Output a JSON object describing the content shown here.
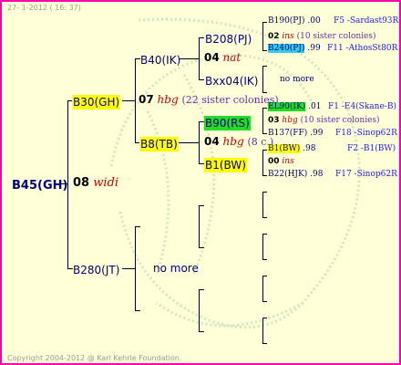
{
  "header": {
    "stamp": "27- 1-2012 ( 16: 37)"
  },
  "footer": {
    "copyright": "Copyright 2004-2012 @ Karl Kehrle Foundation."
  },
  "root": {
    "id": "B45(GH)",
    "year": "08",
    "queen": "widi"
  },
  "sire_side": {
    "id": "B30(GH)",
    "year": "07",
    "queen": "hbg",
    "sisters": "(22 sister colonies)",
    "up": {
      "id": "B40(IK)"
    },
    "down": {
      "id": "B8(TB)",
      "year": "04",
      "queen": "hbg",
      "sisters": "(8 c.)"
    },
    "upup": {
      "id": "B208(PJ)",
      "year": "04",
      "queen": "nat"
    },
    "updown": {
      "id": "Bxx04(IK)",
      "label": "no more"
    },
    "downup": {
      "id": "B90(RS)",
      "year": "03",
      "queen": "hbg",
      "sisters": "(10 sister colonies)"
    },
    "downdown": {
      "id": "B1(BW)",
      "year": "00",
      "queen": "ins"
    }
  },
  "dam_side": {
    "id": "B280(JT)",
    "label": "no more"
  },
  "right_column": [
    {
      "key": "r1",
      "id": "B190(PJ)",
      "year": ".00",
      "ref": "F5 -Sardast93R"
    },
    {
      "key": "r2",
      "year": "02",
      "queen": "ins",
      "sisters": "(10 sister colonies)"
    },
    {
      "key": "r3",
      "id": "B240(PJ)",
      "year": ".99",
      "ref": "F11 -AthosSt80R"
    },
    {
      "key": "r4",
      "label": "no more"
    },
    {
      "key": "r5",
      "id": "EL90(IK)",
      "year": ".01",
      "ref": "F1 -E4(Skane-B)"
    },
    {
      "key": "r6",
      "year": "03",
      "queen": "hbg",
      "sisters": "(10 sister colonies)"
    },
    {
      "key": "r7",
      "id": "B137(FF)",
      "year": ".99",
      "ref": "F18 -Sinop62R"
    },
    {
      "key": "r8",
      "id": "B1(BW)",
      "year": ".98",
      "ref": "F2 -B1(BW)"
    },
    {
      "key": "r9",
      "year": "00",
      "queen": "ins"
    },
    {
      "key": "r10",
      "id": "B22(HJK)",
      "year": ".98",
      "ref": "F17 -Sinop62R"
    }
  ]
}
